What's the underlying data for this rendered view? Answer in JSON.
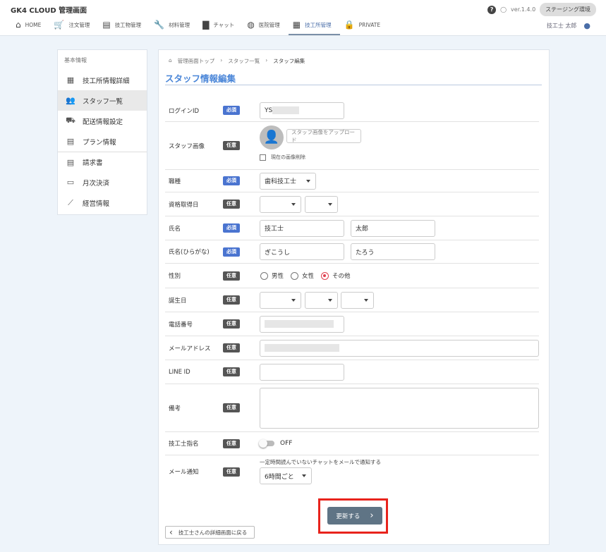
{
  "header": {
    "title": "GK4 CLOUD 管理画面",
    "version": "ver.1.4.0",
    "env": "ステージング環境",
    "user": "技工士 太郎",
    "nav": [
      {
        "label": "HOME",
        "icon": "home-icon",
        "g": "⌂"
      },
      {
        "label": "注文管理",
        "icon": "cart-icon",
        "g": "🛒"
      },
      {
        "label": "技工物管理",
        "icon": "store-icon",
        "g": "▤"
      },
      {
        "label": "材料管理",
        "icon": "wrench-icon",
        "g": "🔧"
      },
      {
        "label": "チャット",
        "icon": "chat-icon",
        "g": "▇"
      },
      {
        "label": "医院管理",
        "icon": "clinic-icon",
        "g": "◍"
      },
      {
        "label": "技工所管理",
        "icon": "building-icon",
        "g": "▦"
      },
      {
        "label": "PRIVATE",
        "icon": "lock-icon",
        "g": "🔒"
      }
    ]
  },
  "sidebar": {
    "heading": "基本情報",
    "items": [
      {
        "label": "技工所情報詳細",
        "g": "▦"
      },
      {
        "label": "スタッフ一覧",
        "g": "👥"
      },
      {
        "label": "配送情報設定",
        "g": "⛟"
      },
      {
        "label": "プラン情報",
        "g": "▤"
      },
      {
        "label": "請求書",
        "g": "▤"
      },
      {
        "label": "月次決済",
        "g": "▭"
      },
      {
        "label": "経営情報",
        "g": "⟋"
      }
    ]
  },
  "breadcrumb": [
    "管理画面トップ",
    "スタッフ一覧",
    "スタッフ編集"
  ],
  "page_title": "スタッフ情報編集",
  "badges": {
    "required": "必須",
    "optional": "任意"
  },
  "form": {
    "login_id": {
      "label": "ログインID",
      "value": "YS"
    },
    "image": {
      "label": "スタッフ画像",
      "upload": "スタッフ画像をアップロード",
      "delete": "現在の画像削除"
    },
    "job": {
      "label": "職種",
      "value": "歯科技工士"
    },
    "qual": {
      "label": "資格取得日"
    },
    "name": {
      "label": "氏名",
      "last": "技工士",
      "first": "太郎"
    },
    "kana": {
      "label": "氏名(ひらがな)",
      "last": "ぎこうし",
      "first": "たろう"
    },
    "gender": {
      "label": "性別",
      "options": [
        "男性",
        "女性",
        "その他"
      ],
      "selected": "その他"
    },
    "birth": {
      "label": "誕生日"
    },
    "phone": {
      "label": "電話番号"
    },
    "email": {
      "label": "メールアドレス"
    },
    "line": {
      "label": "LINE ID"
    },
    "memo": {
      "label": "備考"
    },
    "tech": {
      "label": "技工士指名",
      "toggle": "OFF"
    },
    "mail": {
      "label": "メール通知",
      "hint": "一定時間読んでいないチャットをメールで通知する",
      "value": "6時間ごと"
    }
  },
  "submit": "更新する",
  "back": "技工士さんの詳細画面に戻る"
}
